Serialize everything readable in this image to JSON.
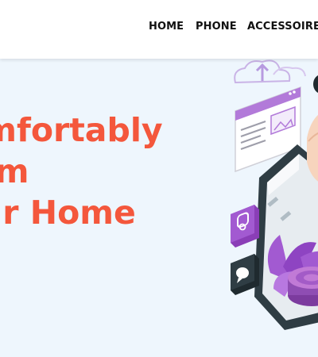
{
  "nav": {
    "items": [
      {
        "label": "HOME"
      },
      {
        "label": "PHONE"
      },
      {
        "label": "ACCESSOIRES"
      }
    ]
  },
  "hero": {
    "headline_lines": [
      "Comfortably",
      "From",
      "Your Home"
    ]
  },
  "colors": {
    "headline": "#f4573c",
    "hero_background": "#eef6fd",
    "accent_purple": "#a25ad1",
    "phone_dark": "#2f3d44"
  },
  "icons": [
    "cloud-upload-icon",
    "browser-window-icon",
    "instagram-icon",
    "chat-bubble-icon",
    "phone-illustration",
    "plant-illustration"
  ]
}
